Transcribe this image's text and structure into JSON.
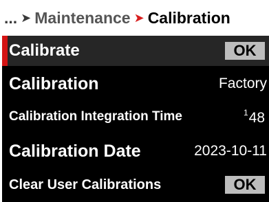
{
  "breadcrumb": {
    "ellipsis": "...",
    "separator1": "➤",
    "parent": "Maintenance",
    "separator2": "➤",
    "current": "Calibration"
  },
  "rows": [
    {
      "label": "Calibrate",
      "button_label": "OK",
      "selected": true
    },
    {
      "label": "Calibration",
      "value": "Factory"
    },
    {
      "label": "Calibration Integration Time",
      "value_numerator": "1",
      "value_slash": "/",
      "value_denominator": "48"
    },
    {
      "label": "Calibration Date",
      "value": "2023-10-11"
    },
    {
      "label": "Clear User Calibrations",
      "button_label": "OK"
    }
  ],
  "colors": {
    "accent_red": "#d41414",
    "background": "#000000",
    "selected_row": "#262626",
    "button": "#bdbdbd"
  }
}
